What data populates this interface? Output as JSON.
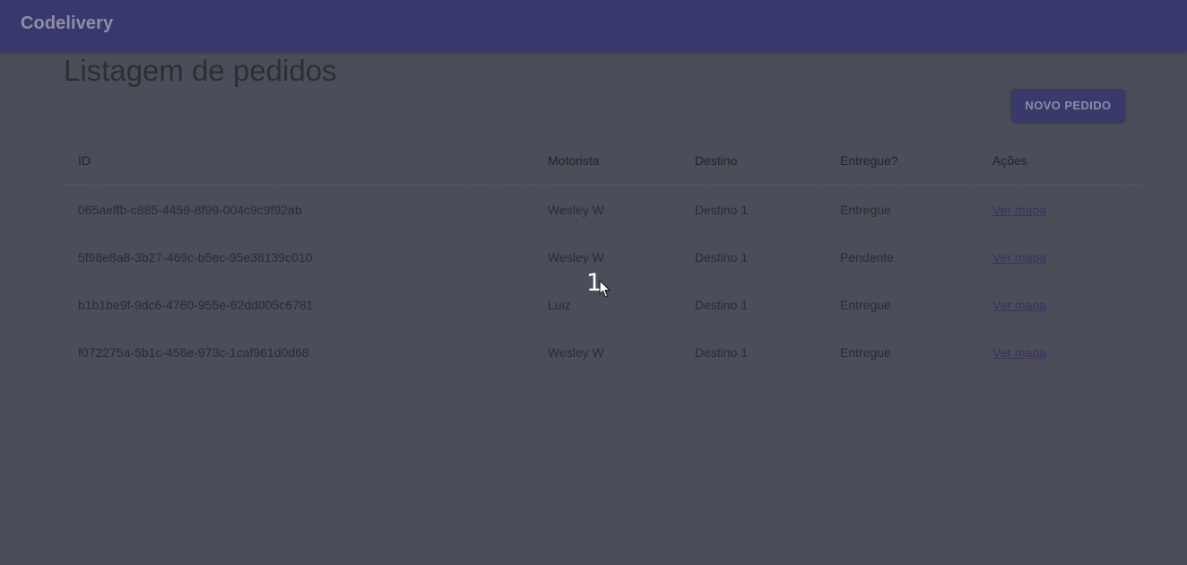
{
  "app": {
    "brand": "Codelivery"
  },
  "page": {
    "title": "Listagem de pedidos",
    "new_button_label": "NOVO PEDIDO"
  },
  "table": {
    "headers": [
      "ID",
      "Motorista",
      "Destino",
      "Entregue?",
      "Ações"
    ],
    "rows": [
      {
        "id": "065aeffb-c885-4459-8f99-004c9c9f92ab",
        "motorista": "Wesley W",
        "destino": "Destino 1",
        "entregue": "Entregue",
        "acao": "Ver mapa"
      },
      {
        "id": "5f98e8a8-3b27-469c-b5ec-95e38139c010",
        "motorista": "Wesley W",
        "destino": "Destino 1",
        "entregue": "Pendente",
        "acao": "Ver mapa"
      },
      {
        "id": "b1b1be9f-9dc6-4760-955e-62dd005c6781",
        "motorista": "Luiz",
        "destino": "Destino 1",
        "entregue": "Entregue",
        "acao": "Ver mapa"
      },
      {
        "id": "f072275a-5b1c-456e-973c-1caf961d0d68",
        "motorista": "Wesley W",
        "destino": "Destino 1",
        "entregue": "Entregue",
        "acao": "Ver mapa"
      }
    ]
  },
  "overlay": {
    "step_number": "1",
    "cursor_icon": "mouse-pointer-icon"
  },
  "colors": {
    "appbar": "#38386d",
    "background": "#4b4e59",
    "primary_button": "#39396c",
    "link": "#3b2f5f"
  }
}
